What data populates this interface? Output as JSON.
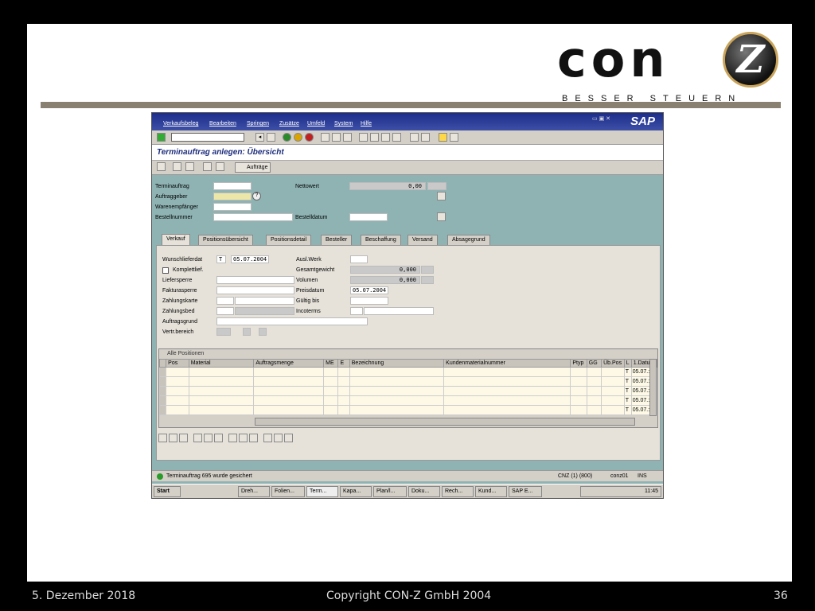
{
  "logo": {
    "text": "con",
    "mark": "Z",
    "tagline": "BESSER STEUERN"
  },
  "footer": {
    "date": "5. Dezember 2018",
    "copyright": "Copyright CON-Z GmbH 2004",
    "page": "36"
  },
  "sap": {
    "menu": [
      "Verkaufsbeleg",
      "Bearbeiten",
      "Springen",
      "Zusätze",
      "Umfeld",
      "System",
      "Hilfe"
    ],
    "brand": "SAP",
    "title": "Terminauftrag anlegen: Übersicht",
    "toolbar2": {
      "auftraege_label": "Aufträge"
    },
    "header_fields": {
      "terminauftrag": "Terminauftrag",
      "auftraggeber": "Auftraggeber",
      "warenempfaenger": "Warenempfänger",
      "bestellnummer": "Bestellnummer",
      "nettowert": "Nettowert",
      "nettowert_value": "0,00",
      "bestelldatum": "Bestelldatum"
    },
    "tabs": [
      "Verkauf",
      "Positionsübersicht",
      "Positionsdetail",
      "Besteller",
      "Beschaffung",
      "Versand",
      "Absagegrund"
    ],
    "verkauf": {
      "wunschlieferdat": "Wunschlieferdat",
      "wunsch_t": "T",
      "wunsch_date": "05.07.2004",
      "komplettlief": "Komplettlief.",
      "liefersperre": "Liefersperre",
      "fakturasperre": "Fakturasperre",
      "zahlungskarte": "Zahlungskarte",
      "zahlungsbed": "Zahlungsbed",
      "auftragsgrund": "Auftragsgrund",
      "vertr_bereich": "Vertr.bereich",
      "ausliefwerk": "Ausl.Werk",
      "gesamtgewicht": "Gesamtgewicht",
      "gesamtgewicht_value": "0,000",
      "volumen": "Volumen",
      "volumen_value": "0,000",
      "preisdatum": "Preisdatum",
      "preisdatum_value": "05.07.2004",
      "gueltig_bis": "Gültig bis",
      "incoterms": "Incoterms"
    },
    "grid": {
      "title": "Alle Positionen",
      "columns": [
        "Pos",
        "Material",
        "Auftragsmenge",
        "ME",
        "E",
        "Bezeichnung",
        "Kundenmaterialnummer",
        "Ptyp",
        "GG",
        "Üb.Pos",
        "L",
        "1.Datum"
      ],
      "rows": [
        {
          "l": "T",
          "datum": "05.07.:"
        },
        {
          "l": "T",
          "datum": "05.07.:"
        },
        {
          "l": "T",
          "datum": "05.07.:"
        },
        {
          "l": "T",
          "datum": "05.07.:"
        },
        {
          "l": "T",
          "datum": "05.07.:"
        }
      ]
    },
    "status": {
      "message": "Terminauftrag 695 wurde gesichert",
      "system": "CNZ (1) (800)",
      "host": "conz01",
      "mode": "INS"
    },
    "taskbar": {
      "start": "Start",
      "items": [
        "Dreh...",
        "Folien...",
        "Term...",
        "Kapa...",
        "Plan/l...",
        "Doku...",
        "Rech...",
        "Kund...",
        "SAP E..."
      ],
      "clock": "11:45"
    }
  }
}
